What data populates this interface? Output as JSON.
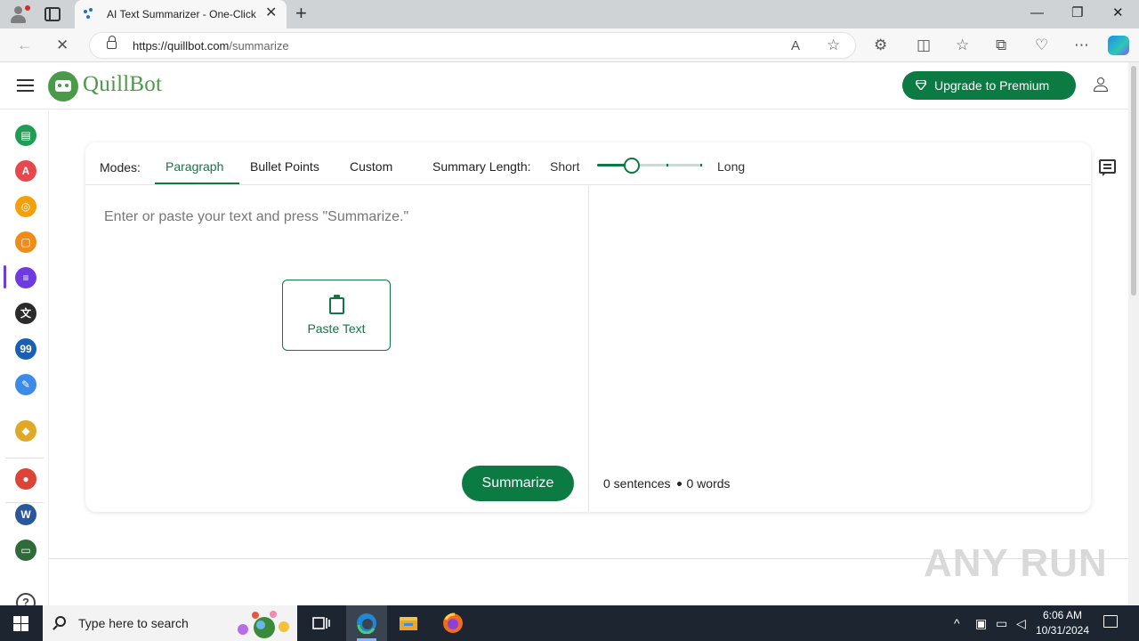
{
  "browser": {
    "tab_title": "AI Text Summarizer - One-Click S",
    "tab_close": "✕",
    "new_tab": "+",
    "url_host": "https://quillbot.com",
    "url_path": "/summarize",
    "window_controls": {
      "minimize": "—",
      "restore": "❐",
      "close": "✕"
    }
  },
  "app": {
    "logo_text": "QuillBot",
    "upgrade_label": "Upgrade to Premium",
    "modes_label": "Modes:",
    "modes": [
      {
        "label": "Paragraph",
        "active": true
      },
      {
        "label": "Bullet Points",
        "active": false
      },
      {
        "label": "Custom",
        "active": false
      }
    ],
    "summary_length": {
      "label": "Summary Length:",
      "min_label": "Short",
      "max_label": "Long",
      "value": 0.33
    },
    "input_placeholder": "Enter or paste your text and press \"Summarize.\"",
    "paste_label": "Paste Text",
    "summarize_label": "Summarize",
    "stats": {
      "sentences": "0 sentences",
      "words": "0 words"
    },
    "help": "?"
  },
  "sidebar": {
    "items": [
      {
        "icon": "paraphraser-icon",
        "color": "#1f9d55",
        "glyph": "▤"
      },
      {
        "icon": "grammar-checker-icon",
        "color": "#e5484d",
        "glyph": "A"
      },
      {
        "icon": "ai-detector-icon",
        "color": "#f59f0b",
        "glyph": "◎"
      },
      {
        "icon": "plagiarism-checker-icon",
        "color": "#f08c1a",
        "glyph": "▢"
      },
      {
        "icon": "summarizer-icon",
        "color": "#6d3be0",
        "glyph": "≡"
      },
      {
        "icon": "translator-icon",
        "color": "#2b2b2b",
        "glyph": "文"
      },
      {
        "icon": "citation-generator-icon",
        "color": "#1a5fb4",
        "glyph": "99"
      },
      {
        "icon": "quillbot-flow-icon",
        "color": "#3d8be6",
        "glyph": "✎"
      },
      {
        "icon": "premium-icon",
        "color": "#e0a826",
        "glyph": "◆"
      },
      {
        "icon": "chrome-extension-icon",
        "color": "#db4437",
        "glyph": "●"
      },
      {
        "icon": "word-addin-icon",
        "color": "#2b579a",
        "glyph": "W"
      },
      {
        "icon": "desktop-app-icon",
        "color": "#2f6b3a",
        "glyph": "▭"
      }
    ]
  },
  "watermark": "ANY RUN",
  "taskbar": {
    "search_placeholder": "Type here to search",
    "time": "6:06 AM",
    "date": "10/31/2024"
  },
  "colors": {
    "brand_green": "#0c7a43",
    "logo_green": "#4a9a4a"
  }
}
